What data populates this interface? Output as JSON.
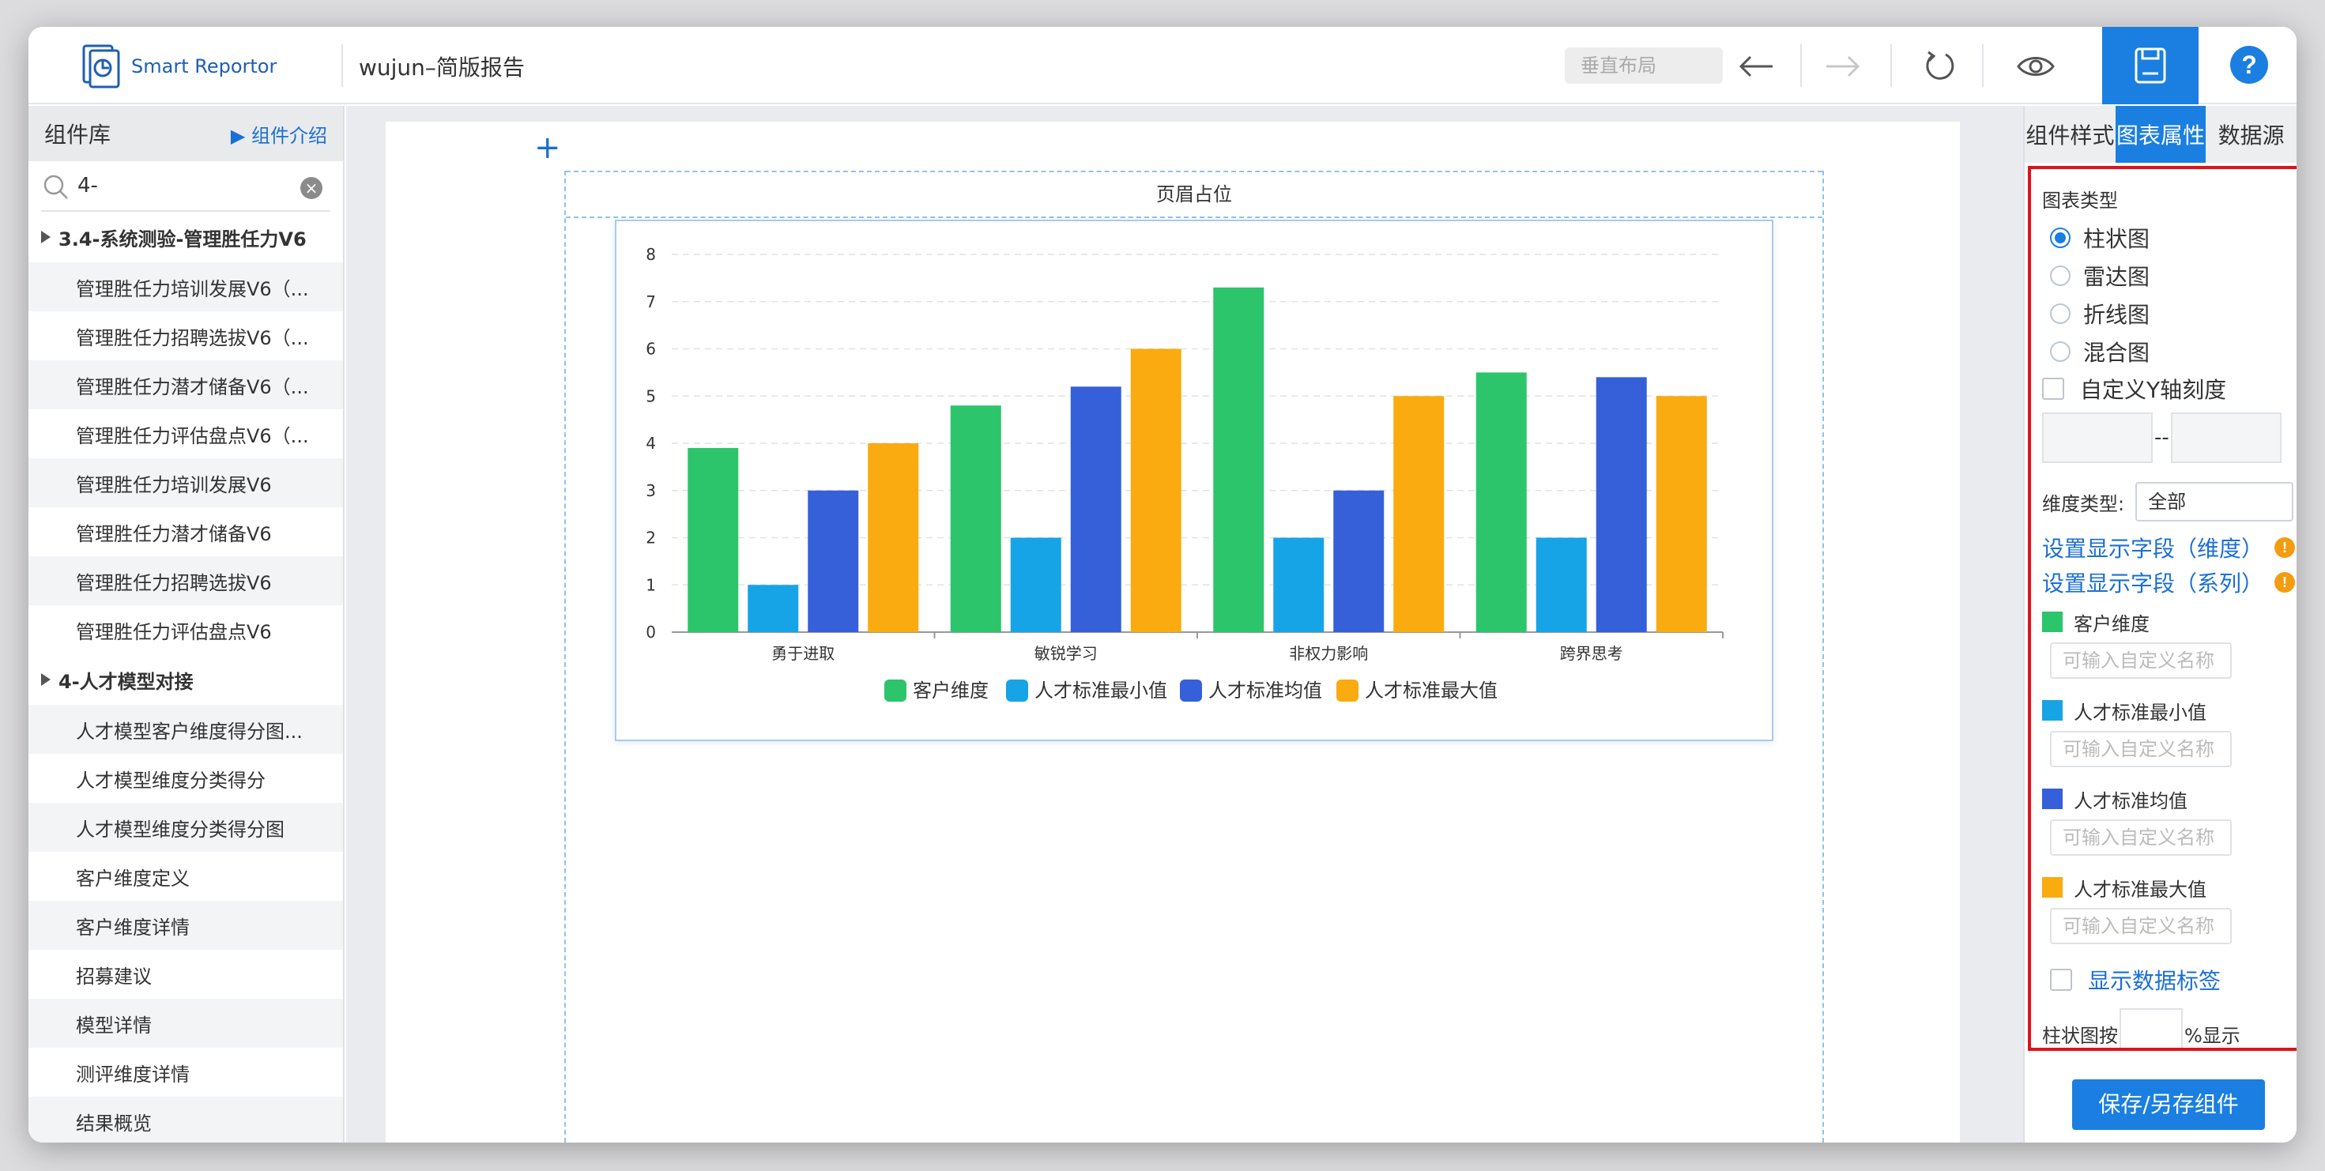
{
  "app": {
    "name": "Smart Reportor",
    "report_title": "wujun–简版报告"
  },
  "toolbar": {
    "layout_label": "垂直布局"
  },
  "left_panel": {
    "title": "组件库",
    "intro_link": "组件介绍",
    "search_value": "4-",
    "groups": [
      {
        "label": "3.4-系统测验-管理胜任力V6",
        "items": [
          "管理胜任力培训发展V6（...",
          "管理胜任力招聘选拔V6（...",
          "管理胜任力潜才储备V6（...",
          "管理胜任力评估盘点V6（...",
          "管理胜任力培训发展V6",
          "管理胜任力潜才储备V6",
          "管理胜任力招聘选拔V6",
          "管理胜任力评估盘点V6"
        ]
      },
      {
        "label": "4-人才模型对接",
        "items": [
          "人才模型客户维度得分图...",
          "人才模型维度分类得分",
          "人才模型维度分类得分图",
          "客户维度定义",
          "客户维度详情",
          "招募建议",
          "模型详情",
          "测评维度详情",
          "结果概览"
        ]
      }
    ]
  },
  "canvas": {
    "plus": "+",
    "header_placeholder": "页眉占位"
  },
  "chart_data": {
    "type": "bar",
    "categories": [
      "勇于进取",
      "敏锐学习",
      "非权力影响",
      "跨界思考"
    ],
    "ylim": [
      0,
      8
    ],
    "yticks": [
      0,
      1,
      2,
      3,
      4,
      5,
      6,
      7,
      8
    ],
    "grid": true,
    "legend_position": "bottom",
    "series": [
      {
        "name": "客户维度",
        "color": "#2dc56b",
        "values": [
          3.9,
          4.8,
          7.3,
          5.5
        ]
      },
      {
        "name": "人才标准最小值",
        "color": "#17a4e6",
        "values": [
          1,
          2,
          2,
          2
        ]
      },
      {
        "name": "人才标准均值",
        "color": "#3560d9",
        "values": [
          3,
          5.2,
          3,
          5.4
        ]
      },
      {
        "name": "人才标准最大值",
        "color": "#f9ab10",
        "values": [
          4,
          6,
          5,
          5
        ]
      }
    ]
  },
  "right_panel": {
    "tabs": [
      "组件样式",
      "图表属性",
      "数据源"
    ],
    "chart_type_label": "图表类型",
    "chart_types": [
      "柱状图",
      "雷达图",
      "折线图",
      "混合图"
    ],
    "custom_y_label": "自定义Y轴刻度",
    "range_dash": "--",
    "dimension_type_label": "维度类型:",
    "dimension_type_value": "全部",
    "set_dim_link": "设置显示字段（维度）",
    "set_series_link": "设置显示字段（系列）",
    "warn_mark": "!",
    "series_labels": [
      "客户维度",
      "人才标准最小值",
      "人才标准均值",
      "人才标准最大值"
    ],
    "alias_placeholder": "可输入自定义名称",
    "show_data_label": "显示数据标签",
    "percent_prefix": "柱状图按",
    "percent_suffix": "%显示",
    "save_button": "保存/另存组件"
  },
  "colors": {
    "accent": "#1a7fe0",
    "highlight_border": "#e0111b"
  }
}
